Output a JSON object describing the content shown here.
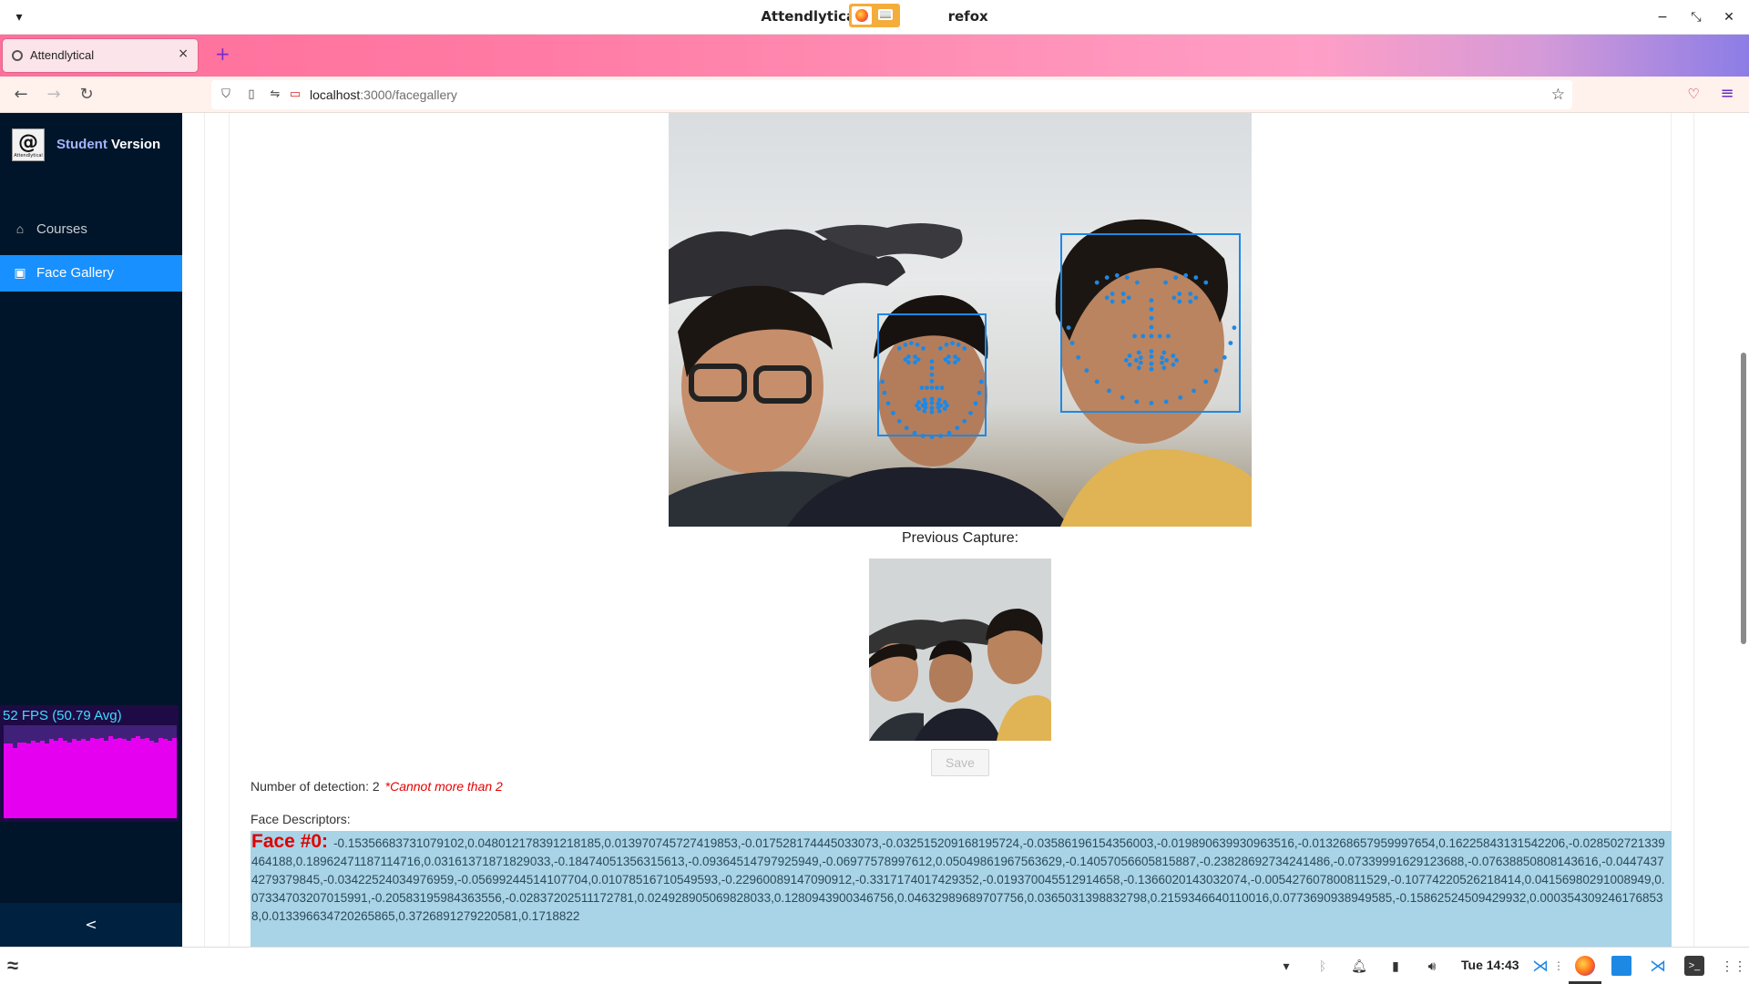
{
  "window": {
    "title": "Attendlytical — Mozilla Firefox",
    "title_display_left": "Attendlytical — M",
    "title_display_right": "refox"
  },
  "browser": {
    "tab": {
      "label": "Attendlytical",
      "close": "×"
    },
    "new_tab": "+",
    "url_host": "localhost",
    "url_path": ":3000/facegallery"
  },
  "sidebar": {
    "brand_mark": "@",
    "brand_mark_caption": "Attendlytical",
    "brand_word1": "Student",
    "brand_word2": "Version",
    "items": [
      {
        "label": "Courses",
        "icon": "home-icon",
        "active": false
      },
      {
        "label": "Face Gallery",
        "icon": "image-icon",
        "active": true
      }
    ],
    "collapse": "<"
  },
  "fps_monitor": {
    "text": "52 FPS (50.79 Avg)",
    "samples": [
      48,
      48,
      45,
      49,
      49,
      48,
      50,
      49,
      50,
      48,
      51,
      50,
      52,
      50,
      49,
      51,
      50,
      51,
      50,
      52,
      51,
      52,
      50,
      53,
      51,
      52,
      51,
      50,
      52,
      53,
      51,
      52,
      50,
      49,
      52,
      51,
      50,
      52
    ]
  },
  "main": {
    "previous_label": "Previous Capture:",
    "save_label": "Save",
    "detection_label": "Number of detection: 2",
    "detection_warning": "*Cannot more than 2",
    "descriptors_label": "Face Descriptors:",
    "face_heading": "Face #0:",
    "face_values": "-0.15356683731079102,0.048012178391218185,0.013970745727419853,-0.017528174445033073,-0.03251520916819572​4,-0.035861961543560​03,-0.019890639930963516,-0.013268657959997654,0.16225843131542206,-0.028502721339464188,0.18962471187114716,0.03161371871829033,-0.18474051356315613,-0.09364514797925949,-0.06977578997612,0.05049861967563629,-0.14057056605815887,-0.23828692734241486,-0.07339991629123688,-0.07638850808143616,-0.04474374279379845,-0.03422524034976959,-0.05699244514107704,0.01078516710549593,-0.22960089147090912,-0.3317174017429352,-0.019370045512914658,-0.1366020143032074,-0.005427607800811529,-0.10774220526218414,0.04156980291008949,0.07334703207015991,-0.20583195984363556,-0.02837202511172781,0.024928905069828033,0.1280943900346756,0.04632989689707756,0.036503139883279​8,0.2159346640110016,0.0773690938949585,-0.15862524509429932,0.0003543092461768538,0.013396634720265865,0.3726891279220581,0.1718822"
  },
  "taskbar": {
    "clock": "Tue 14:43"
  },
  "colors": {
    "sidebar_bg": "#001529",
    "active_item": "#1890ff",
    "face_box": "#1e88e5",
    "landmark": "#1e88e5",
    "descriptor_bg": "#a9d3e6",
    "warning": "#e60000"
  }
}
